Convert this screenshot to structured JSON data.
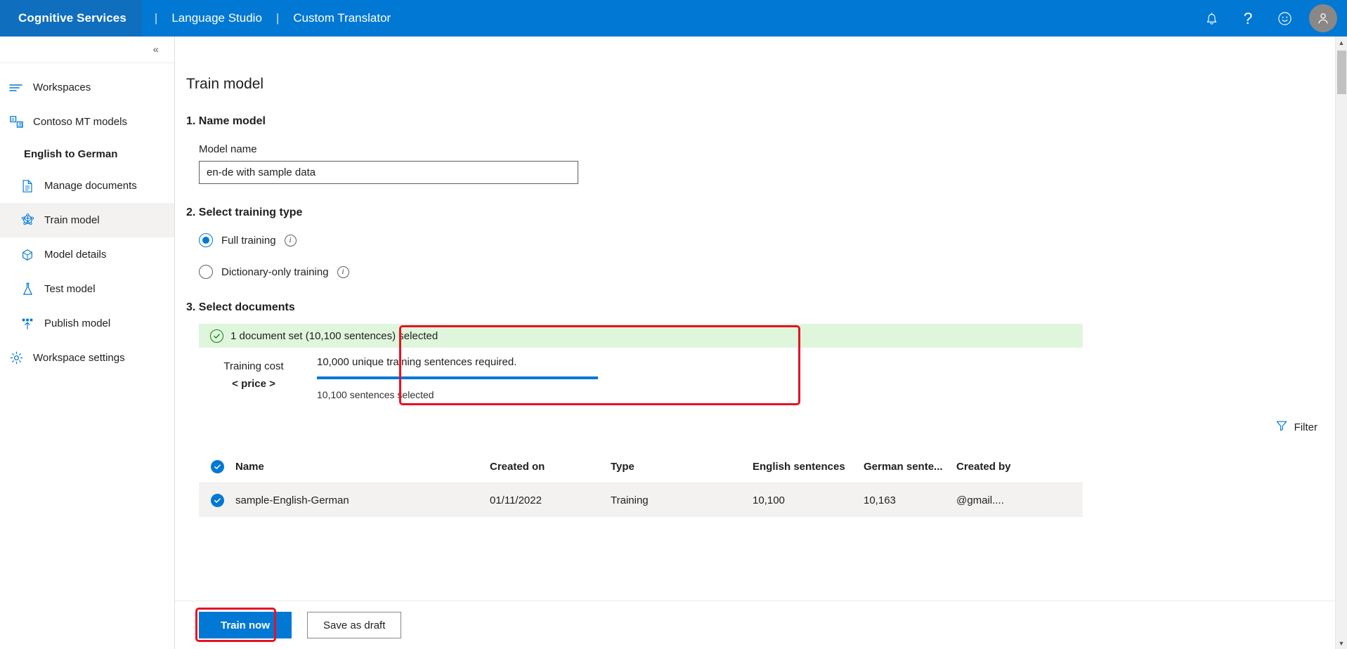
{
  "topbar": {
    "brand": "Cognitive Services",
    "links": [
      "Language Studio",
      "Custom Translator"
    ],
    "separator": "|",
    "icons": {
      "bell": "bell-icon",
      "help": "?",
      "feedback": "smiley-icon",
      "account": "person-icon"
    }
  },
  "sidebar": {
    "collapse_label": "«",
    "items": [
      {
        "label": "Workspaces",
        "icon": "list-icon",
        "type": "top"
      },
      {
        "label": "Contoso MT models",
        "icon": "translate-icon",
        "type": "top"
      },
      {
        "label": "English to German",
        "icon": "",
        "type": "group"
      },
      {
        "label": "Manage documents",
        "icon": "document-icon",
        "type": "sub"
      },
      {
        "label": "Train model",
        "icon": "train-model-icon",
        "type": "sub",
        "selected": true
      },
      {
        "label": "Model details",
        "icon": "package-icon",
        "type": "sub"
      },
      {
        "label": "Test model",
        "icon": "flask-icon",
        "type": "sub"
      },
      {
        "label": "Publish model",
        "icon": "publish-icon",
        "type": "sub"
      },
      {
        "label": "Workspace settings",
        "icon": "gear-icon",
        "type": "top"
      }
    ]
  },
  "main": {
    "page_title": "Train model",
    "step1": {
      "heading": "1. Name model",
      "field_label": "Model name",
      "model_name_value": "en-de with sample data",
      "model_name_placeholder": "Model name"
    },
    "step2": {
      "heading": "2. Select training type",
      "options": [
        {
          "label": "Full training",
          "selected": true,
          "info": "i"
        },
        {
          "label": "Dictionary-only training",
          "selected": false,
          "info": "i"
        }
      ]
    },
    "step3": {
      "heading": "3. Select documents",
      "banner_text": "1 document set (10,100 sentences) selected",
      "cost_title": "Training cost",
      "cost_value": "< price >",
      "requirement_text": "10,000 unique training sentences required.",
      "selected_text": "10,100 sentences selected",
      "progress_percent": 100,
      "filter_label": "Filter"
    },
    "table": {
      "columns": [
        "Name",
        "Created on",
        "Type",
        "English sentences",
        "German sente...",
        "Created by"
      ],
      "rows": [
        {
          "checked": true,
          "name": "sample-English-German",
          "created_on": "01/11/2022",
          "type": "Training",
          "english_sentences": "10,100",
          "german_sentences": "10,163",
          "created_by": "@gmail...."
        }
      ]
    },
    "footer": {
      "primary_button": "Train now",
      "secondary_button": "Save as draft"
    }
  },
  "colors": {
    "brand_blue": "#0078d4",
    "brand_blue_dark": "#106ebe",
    "highlight_red": "#e81123",
    "success_green_bg": "#dff6dd",
    "success_green": "#107c10"
  }
}
